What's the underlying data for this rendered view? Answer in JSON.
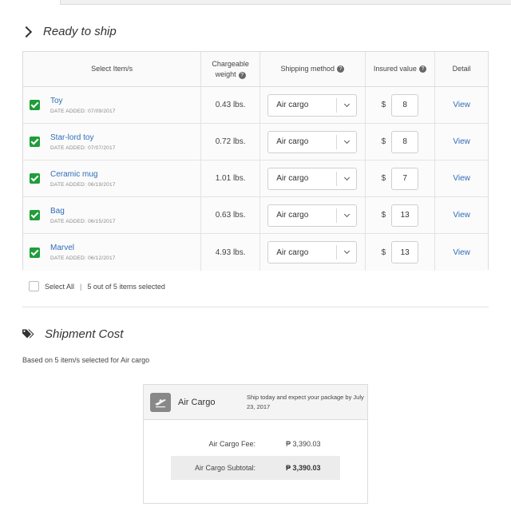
{
  "ready_section": {
    "title": "Ready to ship"
  },
  "table": {
    "headers": {
      "items": "Select Item/s",
      "weight_line1": "Chargeable",
      "weight_line2": "weight",
      "method": "Shipping method",
      "insured": "Insured value",
      "detail": "Detail"
    },
    "rows": [
      {
        "name": "Toy",
        "date": "DATE ADDED: 07/09/2017",
        "weight": "0.43 lbs.",
        "method": "Air cargo",
        "currency": "$",
        "insured": "8",
        "detail": "View"
      },
      {
        "name": "Star-lord toy",
        "date": "DATE ADDED: 07/07/2017",
        "weight": "0.72 lbs.",
        "method": "Air cargo",
        "currency": "$",
        "insured": "8",
        "detail": "View"
      },
      {
        "name": "Ceramic mug",
        "date": "DATE ADDED: 06/19/2017",
        "weight": "1.01 lbs.",
        "method": "Air cargo",
        "currency": "$",
        "insured": "7",
        "detail": "View"
      },
      {
        "name": "Bag",
        "date": "DATE ADDED: 06/15/2017",
        "weight": "0.63 lbs.",
        "method": "Air cargo",
        "currency": "$",
        "insured": "13",
        "detail": "View"
      },
      {
        "name": "Marvel",
        "date": "DATE ADDED: 06/12/2017",
        "weight": "4.93 lbs.",
        "method": "Air cargo",
        "currency": "$",
        "insured": "13",
        "detail": "View"
      }
    ]
  },
  "selection": {
    "select_all": "Select All",
    "separator": "|",
    "count_text": "5 out of 5 items selected"
  },
  "cost_section": {
    "title": "Shipment Cost",
    "based_on": "Based on 5 item/s selected for Air cargo"
  },
  "card": {
    "title": "Air Cargo",
    "note": "Ship today and expect your package by July 23, 2017",
    "fee_label": "Air Cargo Fee:",
    "fee_value": "₱ 3,390.03",
    "subtotal_label": "Air Cargo Subtotal:",
    "subtotal_value": "₱ 3,390.03"
  },
  "colors": {
    "link": "#2f6db8",
    "check": "#1f9d3a"
  },
  "icons": {
    "section_chevron": "chevron-right-icon",
    "cost_section": "tags-icon",
    "card": "airplane-icon",
    "help": "question-circle-icon",
    "dropdown": "chevron-down-icon"
  }
}
